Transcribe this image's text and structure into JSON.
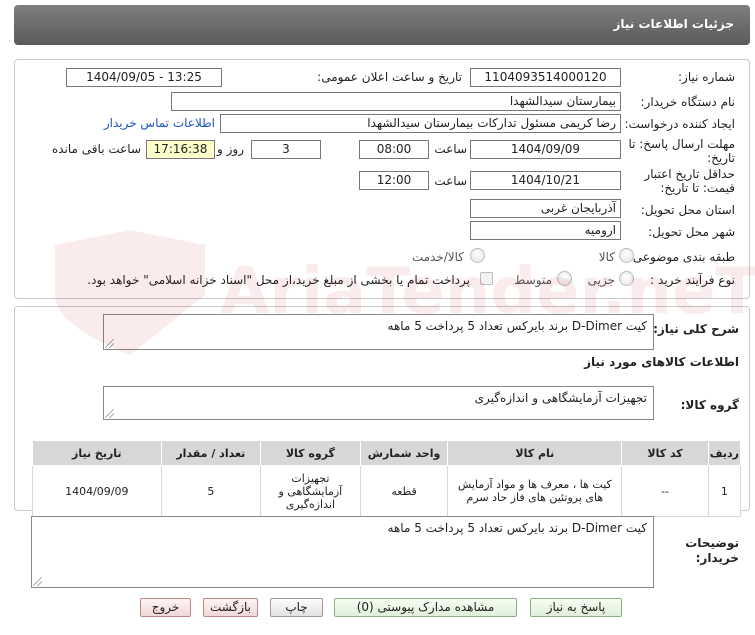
{
  "header": {
    "title": "جزئیات اطلاعات نیاز"
  },
  "form": {
    "need_number_label": "شماره نیاز:",
    "need_number": "1104093514000120",
    "announce_label": "تاریخ و ساعت اعلان عمومی:",
    "announce_value": "1404/09/05 - 13:25",
    "buyer_org_label": "نام دستگاه خریدار:",
    "buyer_org": "بیمارستان سیدالشهدا",
    "requester_label": "ایجاد کننده درخواست:",
    "requester": "رضا کریمی مسئول تدارکات بیمارستان سیدالشهدا",
    "contact_link": "اطلاعات تماس خریدار",
    "deadline_label_1": "مهلت ارسال پاسخ: تا",
    "deadline_label_2": "تاریخ:",
    "deadline_date": "1404/09/09",
    "time_label": "ساعت",
    "deadline_time": "08:00",
    "days_value": "3",
    "days_label": "روز و",
    "remaining_time": "17:16:38",
    "remaining_label": "ساعت باقی مانده",
    "validity_label_1": "حداقل تاریخ اعتبار",
    "validity_label_2": "قیمت: تا تاریخ:",
    "validity_date": "1404/10/21",
    "validity_time": "12:00",
    "province_label": "استان محل تحویل:",
    "province": "آذربایجان غربی",
    "city_label": "شهر محل تحویل:",
    "city": "ارومیه",
    "category_label": "طبقه بندی موضوعی:",
    "category_options": [
      "کالا",
      "کالا/خدمت"
    ],
    "process_label": "نوع فرآیند خرید :",
    "process_options": [
      "جزیی",
      "متوسط"
    ],
    "treasury_note": "پرداخت تمام یا بخشی از مبلغ خرید،از محل \"اسناد خزانه اسلامی\" خواهد بود."
  },
  "summary": {
    "label": "شرح کلی نیاز:",
    "text": "کیت D-Dimer  برند بایرکس تعداد 5 پرداخت 5 ماهه"
  },
  "goods": {
    "section_title": "اطلاعات کالاهای مورد نیاز",
    "group_label": "گروه کالا:",
    "group_value": "تجهیزات آزمایشگاهی و اندازه‌گیری",
    "columns": [
      "ردیف",
      "کد کالا",
      "نام کالا",
      "واحد شمارش",
      "گروه کالا",
      "تعداد / مقدار",
      "تاریخ نیاز"
    ],
    "rows": [
      {
        "row": "1",
        "code": "--",
        "name": "کیت ها ، معرف ها و مواد آزمایش های پروتئین های فاز حاد سرم",
        "unit": "قطعه",
        "group": "تجهیزات آزمایشگاهی و اندازه‌گیری",
        "qty": "5",
        "date": "1404/09/09"
      }
    ]
  },
  "buyer_notes": {
    "label_1": "توضیحات",
    "label_2": "خریدار:",
    "text": "کیت D-Dimer  برند بایرکس تعداد 5 پرداخت 5 ماهه"
  },
  "buttons": {
    "reply": "پاسخ به نیاز",
    "attachments": "مشاهده مدارک پیوستی (0)",
    "print": "چاپ",
    "back": "بازگشت",
    "exit": "خروج"
  },
  "watermark": "AriaTender.neT"
}
